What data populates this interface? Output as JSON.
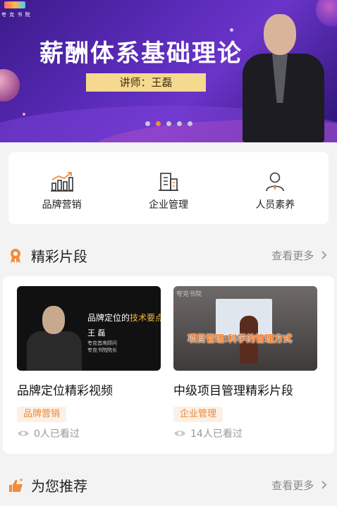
{
  "banner": {
    "logo_text": "夸 克 书 院",
    "title": "薪酬体系基础理论",
    "lecturer": "讲师：王磊",
    "dots_total": 5,
    "dots_active_index": 1
  },
  "categories": [
    {
      "label": "品牌营销",
      "icon": "bar-chart-trend-icon"
    },
    {
      "label": "企业管理",
      "icon": "building-icon"
    },
    {
      "label": "人员素养",
      "icon": "person-icon"
    }
  ],
  "highlights": {
    "title": "精彩片段",
    "more": "查看更多",
    "items": [
      {
        "thumb_line1a": "品牌定位的",
        "thumb_line1b": "技术要点",
        "thumb_name": "王 磊",
        "thumb_role1": "夸克首席顾问",
        "thumb_role2": "夸克书院院长",
        "title": "品牌定位精彩视频",
        "tag": "品牌营销",
        "views": "0人已看过"
      },
      {
        "thumb_watermark": "夸克书院",
        "thumb_caption": "项目管理:科学的管理方式",
        "title": "中级项目管理精彩片段",
        "tag": "企业管理",
        "views": "14人已看过"
      }
    ]
  },
  "recommend": {
    "title": "为您推荐",
    "more": "查看更多"
  },
  "colors": {
    "accent": "#f28c3c",
    "tag_text": "#e88a3a",
    "tag_bg": "#fdf0e4",
    "banner_gold": "#f5d98f"
  }
}
